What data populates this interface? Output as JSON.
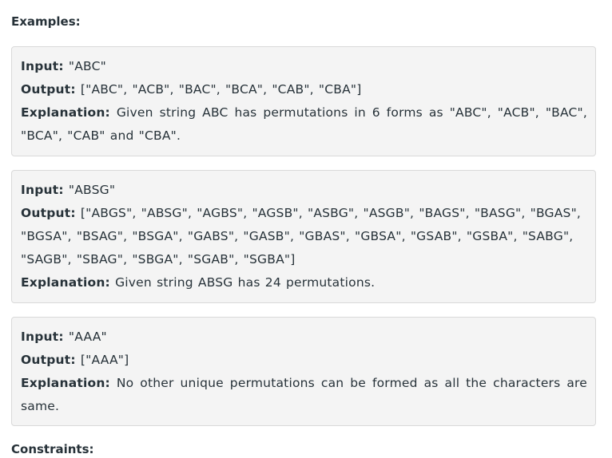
{
  "headings": {
    "examples": "Examples:",
    "constraints": "Constraints:"
  },
  "examples": [
    {
      "input_label": "Input:",
      "input_value": "\"ABC\"",
      "output_label": "Output:",
      "output_value": "[\"ABC\", \"ACB\", \"BAC\", \"BCA\", \"CAB\", \"CBA\"]",
      "explanation_label": "Explanation:",
      "explanation_value": "Given string ABC has permutations in 6 forms as \"ABC\", \"ACB\", \"BAC\", \"BCA\", \"CAB\" and \"CBA\"."
    },
    {
      "input_label": "Input:",
      "input_value": "\"ABSG\"",
      "output_label": "Output:",
      "output_value": "[\"ABGS\", \"ABSG\", \"AGBS\", \"AGSB\", \"ASBG\", \"ASGB\", \"BAGS\", \"BASG\", \"BGAS\", \"BGSA\", \"BSAG\", \"BSGA\", \"GABS\", \"GASB\", \"GBAS\", \"GBSA\", \"GSAB\", \"GSBA\", \"SABG\", \"SAGB\", \"SBAG\", \"SBGA\", \"SGAB\", \"SGBA\"]",
      "explanation_label": "Explanation:",
      "explanation_value": "Given string ABSG has 24 permutations."
    },
    {
      "input_label": "Input:",
      "input_value": "\"AAA\"",
      "output_label": "Output:",
      "output_value": "[\"AAA\"]",
      "explanation_label": "Explanation:",
      "explanation_value": "No other unique permutations can be formed as all the characters are same."
    }
  ]
}
